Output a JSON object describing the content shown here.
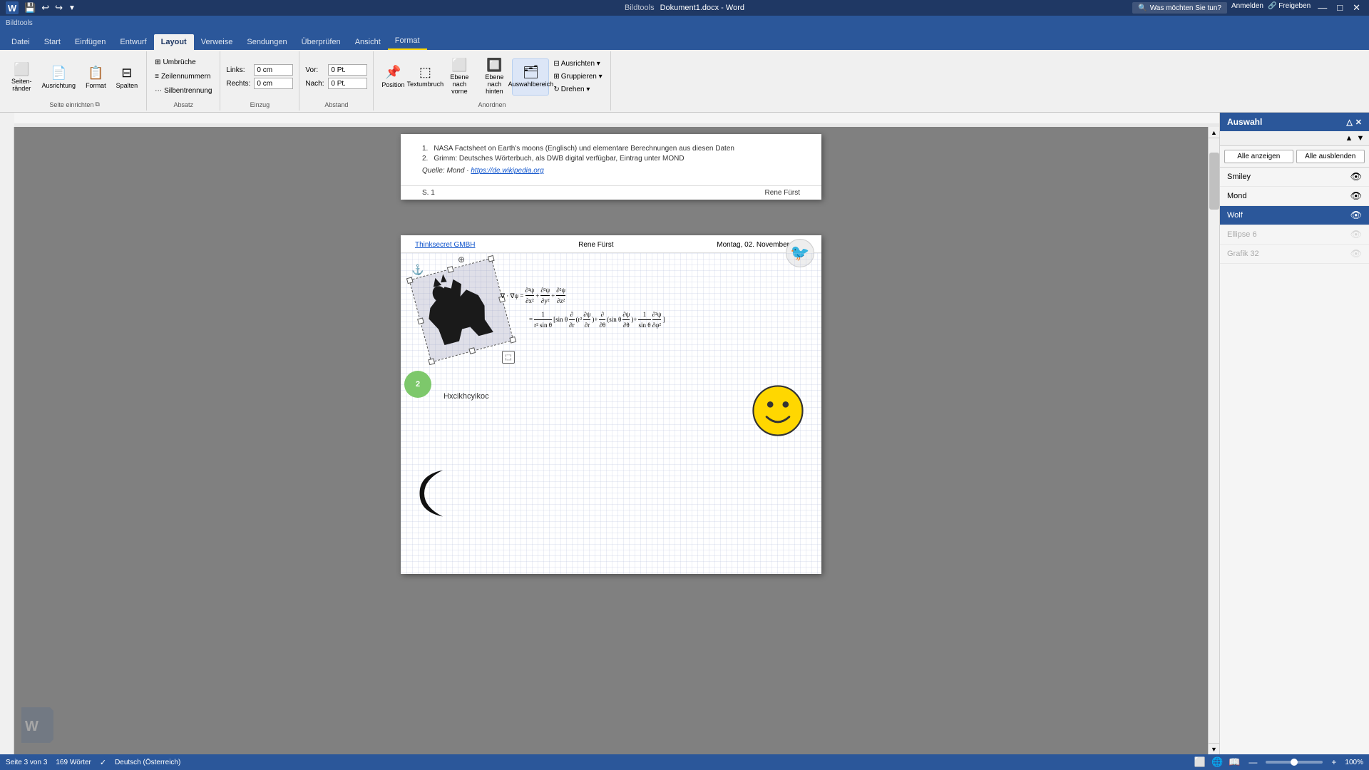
{
  "titlebar": {
    "app_name": "Bildtools",
    "doc_title": "Dokument1.docx - Word",
    "minimize": "—",
    "maximize": "□",
    "close": "✕"
  },
  "quickaccess": {
    "save": "💾",
    "undo": "↩",
    "redo": "↪",
    "more": "▼"
  },
  "ribbon": {
    "tabs": [
      "Datei",
      "Start",
      "Einfügen",
      "Entwurf",
      "Layout",
      "Verweise",
      "Sendungen",
      "Überprüfen",
      "Ansicht",
      "Format"
    ],
    "active_tab": "Layout",
    "bildtools_label": "Bildtools",
    "groups": {
      "seite_einrichten": {
        "label": "Seite einrichten",
        "btn1": "Seiten-\nränder",
        "btn2": "Ausrichtung",
        "btn3": "Format",
        "btn4": "Spalten"
      },
      "absatz": {
        "label": "Absatz",
        "links_label": "Links:",
        "links_value": "0 cm",
        "rechts_label": "Rechts:",
        "rechts_value": "0 cm",
        "umbrueche": "Umbrüche",
        "zeilennummern": "Zeilennummern",
        "silbentrennung": "Silbentrennung"
      },
      "einzug": {
        "label": "Einzug",
        "vor_label": "Vor:",
        "vor_value": "0 Pt.",
        "nach_label": "Nach:",
        "nach_value": "0 Pt."
      },
      "anordnen": {
        "label": "Anordnen",
        "position": "Position",
        "textumbruch": "Textumbruch",
        "ebene_vorne": "Ebene nach\nvorne",
        "ebene_hinten": "Ebene nach\nhinten",
        "auswahlbereich": "Auswahlbereich",
        "ausrichten": "Ausrichten",
        "gruppieren": "Gruppieren",
        "drehen": "Drehen"
      }
    }
  },
  "document": {
    "page1_bottom": {
      "list_item1": "NASA Factsheet on Earth's moons (Englisch) und elementare Berechnungen aus diesen Daten",
      "list_item2": "Grimm: Deutsches Wörterbuch, als DWB digital verfügbar, Eintrag unter MOND",
      "source_label": "Quelle: Mond · ",
      "source_link": "https://de.wikipedia.org",
      "page_num": "S. 1",
      "author": "Rene Fürst"
    },
    "page2": {
      "header_left": "Thinksecret GMBH",
      "header_center": "Rene Fürst",
      "header_date": "Montag, 02. November 2015",
      "text": "Hxcikhcyikoc",
      "page_footer_num": "",
      "page_footer_author": ""
    }
  },
  "selection_pane": {
    "title": "Auswahl",
    "show_all": "Alle anzeigen",
    "hide_all": "Alle ausblenden",
    "items": [
      {
        "name": "Smiley",
        "visible": true,
        "selected": false,
        "grayed": false
      },
      {
        "name": "Mond",
        "visible": true,
        "selected": false,
        "grayed": false
      },
      {
        "name": "Wolf",
        "visible": true,
        "selected": true,
        "grayed": false
      },
      {
        "name": "Ellipse 6",
        "visible": false,
        "selected": false,
        "grayed": true
      },
      {
        "name": "Grafik 32",
        "visible": false,
        "selected": false,
        "grayed": true
      }
    ]
  },
  "statusbar": {
    "page_info": "Seite 3 von 3",
    "word_count": "169 Wörter",
    "language": "Deutsch (Österreich)",
    "zoom_percent": "100%"
  },
  "colors": {
    "ribbon_blue": "#2b579a",
    "title_blue": "#1f3864",
    "selected_blue": "#2b579a",
    "smiley_yellow": "#FFD700",
    "green_circle": "#7dc86b"
  }
}
